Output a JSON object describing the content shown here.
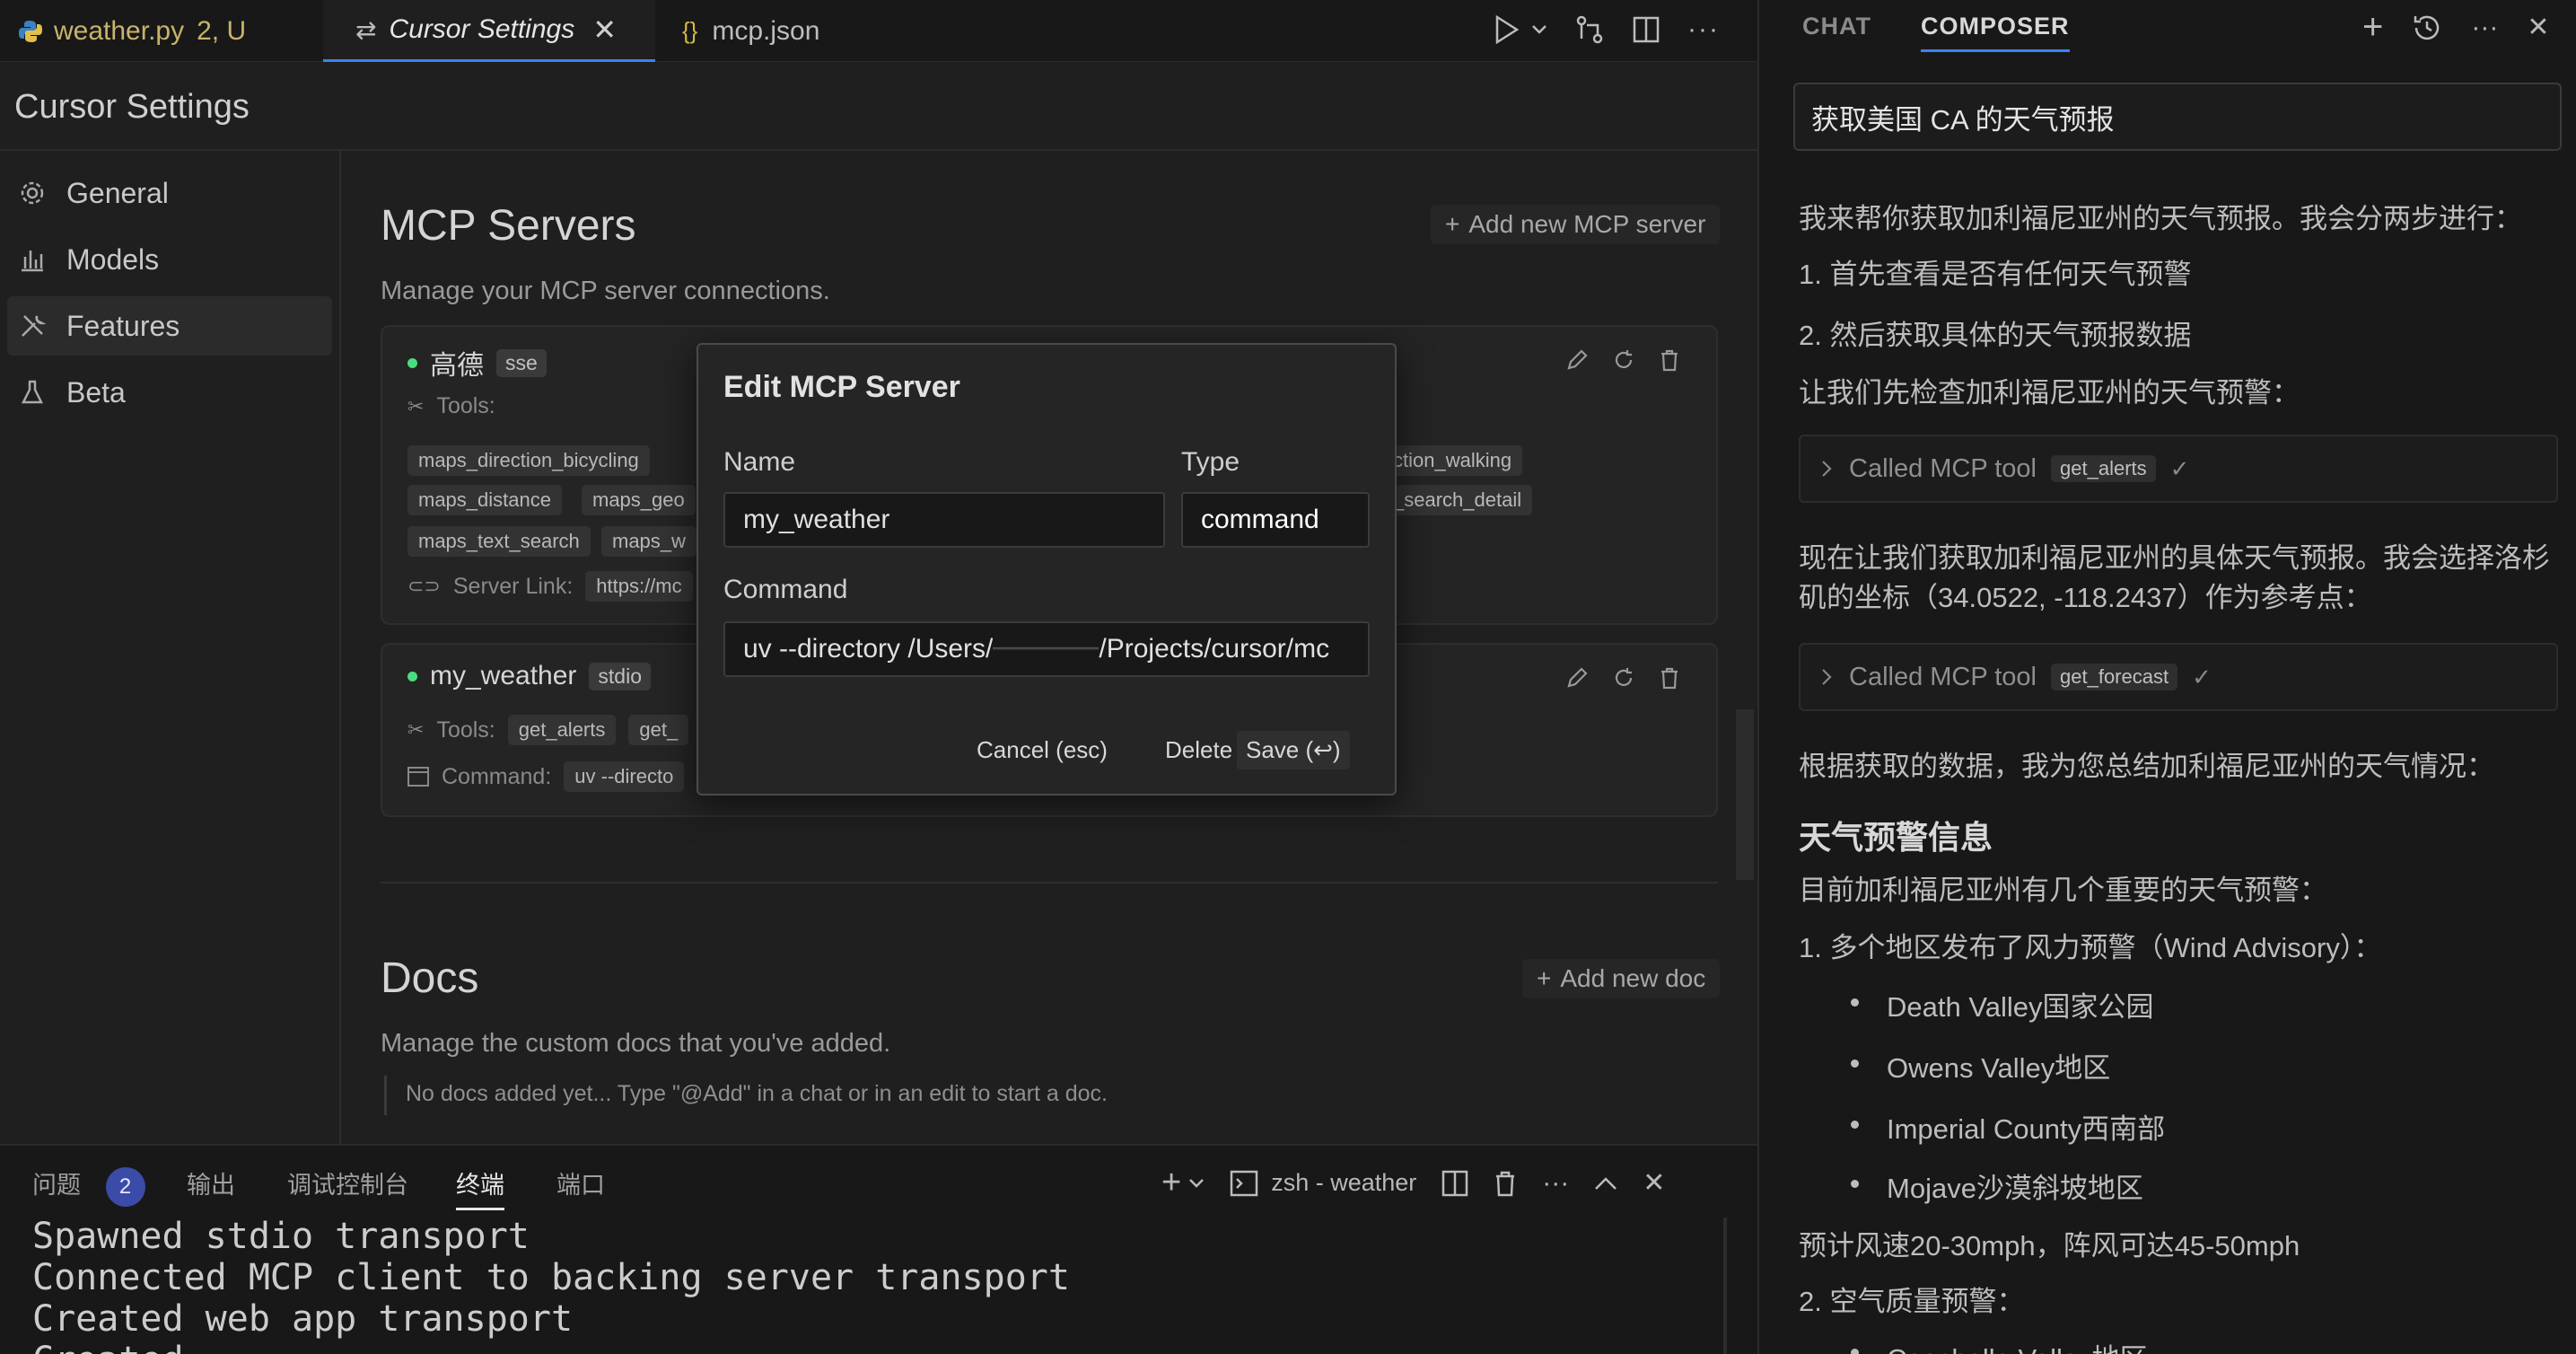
{
  "editor_tabs": [
    {
      "label": "weather.py",
      "badge": "2, U"
    },
    {
      "label": "Cursor Settings"
    },
    {
      "label": "mcp.json"
    }
  ],
  "settings": {
    "title": "Cursor Settings",
    "nav": [
      "General",
      "Models",
      "Features",
      "Beta"
    ],
    "mcp": {
      "title": "MCP Servers",
      "subtitle": "Manage your MCP server connections.",
      "add_label": "Add new MCP server",
      "server1": {
        "name": "高德",
        "type": "sse",
        "tools_label": "Tools:",
        "tools": [
          "maps_direction_bicycling",
          "ction_walking",
          "maps_distance",
          "maps_geo",
          "_search_detail",
          "maps_text_search",
          "maps_w"
        ],
        "link_label": "Server Link:",
        "link_value": "https://mc"
      },
      "server2": {
        "name": "my_weather",
        "type": "stdio",
        "tools_label": "Tools:",
        "tools": [
          "get_alerts",
          "get_"
        ],
        "command_label": "Command:",
        "command_value": "uv --directo"
      }
    },
    "docs": {
      "title": "Docs",
      "subtitle": "Manage the custom docs that you've added.",
      "add_label": "Add new doc",
      "empty": "No docs added yet... Type \"@Add\" in a chat or in an edit to start a doc."
    }
  },
  "modal": {
    "title": "Edit MCP Server",
    "name_label": "Name",
    "name_value": "my_weather",
    "type_label": "Type",
    "type_value": "command",
    "command_label": "Command",
    "command_value": "uv --directory /Users/",
    "command_value_tail": "/Projects/cursor/mc",
    "cancel": "Cancel (esc)",
    "delete": "Delete",
    "save": "Save (↩)"
  },
  "panel": {
    "tabs": [
      "问题",
      "输出",
      "调试控制台",
      "终端",
      "端口"
    ],
    "problems_count": "2",
    "terminal_name": "zsh - weather",
    "lines": [
      "Spawned stdio transport",
      "Connected MCP client to backing server transport",
      "Created web app transport",
      "Created"
    ]
  },
  "chat": {
    "tabs": [
      "CHAT",
      "COMPOSER"
    ],
    "input": "获取美国 CA 的天气预报",
    "p1": "我来帮你获取加利福尼亚州的天气预报。我会分两步进行：",
    "s1": "1. 首先查看是否有任何天气预警",
    "s2": "2. 然后获取具体的天气预报数据",
    "p2": "让我们先检查加利福尼亚州的天气预警：",
    "tool_prefix": "Called MCP tool",
    "tool1": "get_alerts",
    "tool2": "get_forecast",
    "p3a": "现在让我们获取加利福尼亚州的具体天气预报。我会选择洛杉",
    "p3b": "矶的坐标（34.0522, -118.2437）作为参考点：",
    "p4": "根据获取的数据，我为您总结加利福尼亚州的天气情况：",
    "h_alerts": "天气预警信息",
    "p5": "目前加利福尼亚州有几个重要的天气预警：",
    "l1": "1. 多个地区发布了风力预警（Wind Advisory）：",
    "bullets": [
      "Death Valley国家公园",
      "Owens Valley地区",
      "Imperial County西南部",
      "Mojave沙漠斜坡地区"
    ],
    "wind": "预计风速20-30mph，阵风可达45-50mph",
    "l2": "2. 空气质量预警：",
    "cut": "Coachella Valley地区"
  },
  "colors": {
    "accent": "#3b82f6",
    "status_dot": "#4ade80",
    "python": "#3b82c4",
    "json": "#d7ba3d"
  }
}
